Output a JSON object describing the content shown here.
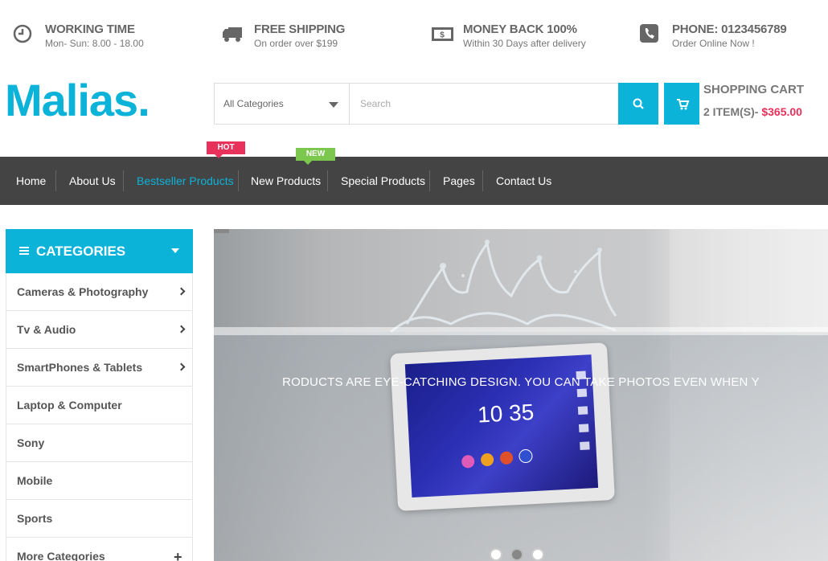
{
  "topbar": {
    "working": {
      "title": "WORKING TIME",
      "sub": "Mon- Sun: 8.00 - 18.00",
      "icon": "clock-icon"
    },
    "shipping": {
      "title": "FREE SHIPPING",
      "sub": "On order over $199",
      "icon": "truck-icon"
    },
    "money": {
      "title": "MONEY BACK 100%",
      "sub": "Within 30 Days after delivery",
      "icon": "money-icon"
    },
    "phone": {
      "title": "PHONE: 0123456789",
      "sub": "Order Online Now !",
      "icon": "phone-icon"
    }
  },
  "header": {
    "logo": "Malias.",
    "category_select": "All Categories",
    "search_placeholder": "Search",
    "cart_title": "SHOPPING CART",
    "cart_items": "2 ITEM(S)-",
    "cart_amount": "$365.00"
  },
  "nav": {
    "items": [
      {
        "label": "Home"
      },
      {
        "label": "About Us"
      },
      {
        "label": "Bestseller Products",
        "active": true,
        "badge": "HOT"
      },
      {
        "label": "New Products",
        "badge": "NEW"
      },
      {
        "label": "Special Products"
      },
      {
        "label": "Pages"
      },
      {
        "label": "Contact Us"
      }
    ]
  },
  "categories": {
    "title": "CATEGORIES",
    "items": [
      {
        "label": "Cameras & Photography",
        "has_sub": true
      },
      {
        "label": "Tv & Audio",
        "has_sub": true
      },
      {
        "label": "SmartPhones & Tablets",
        "has_sub": true
      },
      {
        "label": "Laptop & Computer"
      },
      {
        "label": "Sony"
      },
      {
        "label": "Mobile"
      },
      {
        "label": "Sports"
      },
      {
        "label": "More Categories",
        "expand": "+"
      }
    ]
  },
  "slider": {
    "headline": "RODUCTS ARE EYE-CATCHING DESIGN. YOU CAN TAKE PHOTOS EVEN WHEN Y",
    "clock": "10 35",
    "active_slide": 2,
    "slides": 3
  },
  "colors": {
    "accent": "#0bb3d9",
    "hot": "#e8315b",
    "new": "#7cc84e",
    "nav_bg": "#444444"
  }
}
